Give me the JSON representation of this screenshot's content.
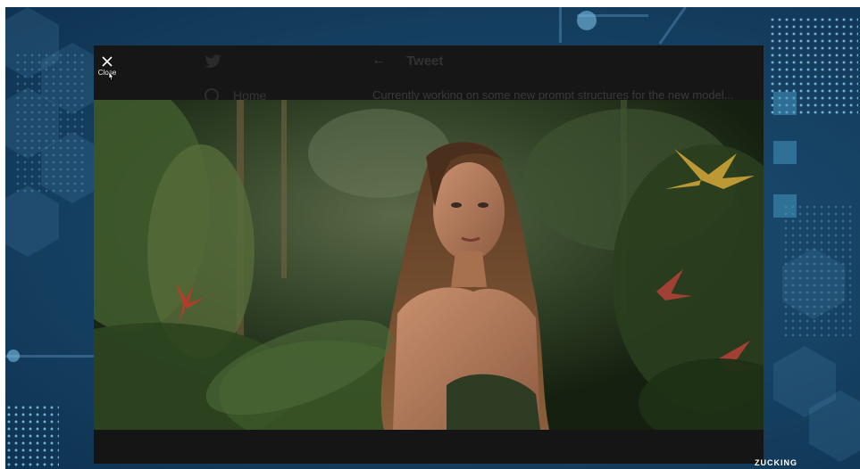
{
  "modal": {
    "close_label": "Close"
  },
  "background_page": {
    "header_title": "Tweet",
    "nav_home": "Home",
    "tweet_text": "Currently working on some new prompt structures for the new model..."
  },
  "image": {
    "alt": "Woman standing in a tropical jungle"
  },
  "watermark": "ZUCKING",
  "colors": {
    "backdrop": "#174466",
    "modal": "#161616",
    "accent_dots": "#8ccdf0"
  }
}
